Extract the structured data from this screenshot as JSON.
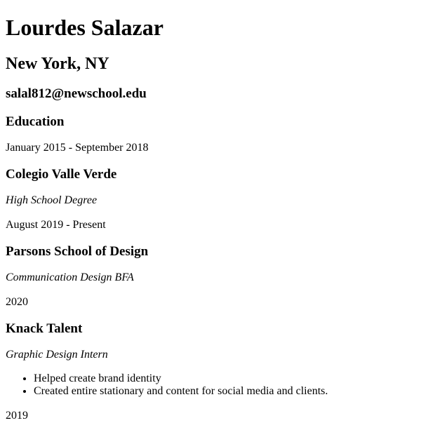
{
  "header": {
    "name": "Lourdes Salazar",
    "location": "New York, NY",
    "email": "salal812@newschool.edu"
  },
  "sections": {
    "education_heading": "Education"
  },
  "entries": [
    {
      "dates": "January 2015 - September 2018",
      "org": "Colegio Valle Verde",
      "role": "High School Degree"
    },
    {
      "dates": "August 2019 - Present",
      "org": "Parsons School of Design",
      "role": "Communication Design BFA"
    },
    {
      "dates": "2020",
      "org": "Knack Talent",
      "role": "Graphic Design Intern",
      "bullets": [
        "Helped create brand identity",
        "Created entire stationary and content for social media and clients."
      ]
    },
    {
      "dates": "2019"
    }
  ]
}
